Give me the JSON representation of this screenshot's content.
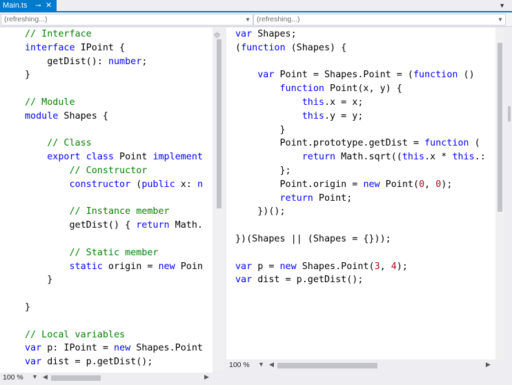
{
  "tab": {
    "title": "Main.ts",
    "pin_glyph": "⊸",
    "close_glyph": "✕"
  },
  "navbar": {
    "left_combo": "(refreshing...)",
    "right_combo": "(refreshing...)"
  },
  "left_zoom": "100 %",
  "right_zoom": "100 %",
  "left_code": [
    [
      [
        "cm",
        "// Interface"
      ]
    ],
    [
      [
        "kw",
        "interface"
      ],
      [
        "",
        "IPoint {"
      ]
    ],
    [
      [
        "",
        "    getDist(): "
      ],
      [
        "kw",
        "number"
      ],
      [
        "",
        ";"
      ]
    ],
    [
      [
        "",
        "}"
      ]
    ],
    [
      [
        "",
        ""
      ]
    ],
    [
      [
        "cm",
        "// Module"
      ]
    ],
    [
      [
        "kw",
        "module"
      ],
      [
        "",
        "Shapes {"
      ]
    ],
    [
      [
        "",
        ""
      ]
    ],
    [
      [
        "",
        "    "
      ],
      [
        "cm",
        "// Class"
      ]
    ],
    [
      [
        "",
        "    "
      ],
      [
        "kw",
        "export"
      ],
      [
        "",
        ""
      ],
      [
        "kw",
        "class"
      ],
      [
        "",
        "Point "
      ],
      [
        "kw",
        "implement"
      ]
    ],
    [
      [
        "",
        "        "
      ],
      [
        "cm",
        "// Constructor"
      ]
    ],
    [
      [
        "",
        "        "
      ],
      [
        "kw",
        "constructor"
      ],
      [
        "",
        " ("
      ],
      [
        "kw",
        "public"
      ],
      [
        "",
        " x: "
      ],
      [
        "kw",
        "n"
      ]
    ],
    [
      [
        "",
        ""
      ]
    ],
    [
      [
        "",
        "        "
      ],
      [
        "cm",
        "// Instance member"
      ]
    ],
    [
      [
        "",
        "        getDist() { "
      ],
      [
        "kw",
        "return"
      ],
      [
        "",
        " Math."
      ]
    ],
    [
      [
        "",
        ""
      ]
    ],
    [
      [
        "",
        "        "
      ],
      [
        "cm",
        "// Static member"
      ]
    ],
    [
      [
        "",
        "        "
      ],
      [
        "kw",
        "static"
      ],
      [
        "",
        " origin = "
      ],
      [
        "kw",
        "new"
      ],
      [
        "",
        " Poin"
      ]
    ],
    [
      [
        "",
        "    }"
      ]
    ],
    [
      [
        "",
        ""
      ]
    ],
    [
      [
        "",
        "}"
      ]
    ],
    [
      [
        "",
        ""
      ]
    ],
    [
      [
        "cm",
        "// Local variables"
      ]
    ],
    [
      [
        "kw",
        "var"
      ],
      [
        "",
        " p: IPoint = "
      ],
      [
        "kw",
        "new"
      ],
      [
        "",
        " Shapes.Point"
      ]
    ],
    [
      [
        "kw",
        "var"
      ],
      [
        "",
        " dist = p.getDist();"
      ]
    ]
  ],
  "right_code": [
    [
      [
        "kw",
        "var"
      ],
      [
        "",
        " Shapes;"
      ]
    ],
    [
      [
        "",
        "("
      ],
      [
        "kw",
        "function"
      ],
      [
        "",
        " (Shapes) {"
      ]
    ],
    [
      [
        "",
        ""
      ]
    ],
    [
      [
        "",
        "    "
      ],
      [
        "kw",
        "var"
      ],
      [
        "",
        " Point = Shapes.Point = ("
      ],
      [
        "kw",
        "function"
      ],
      [
        "",
        " () "
      ]
    ],
    [
      [
        "",
        "        "
      ],
      [
        "kw",
        "function"
      ],
      [
        "",
        " Point(x, y) {"
      ]
    ],
    [
      [
        "",
        "            "
      ],
      [
        "kw",
        "this"
      ],
      [
        "",
        ".x = x;"
      ]
    ],
    [
      [
        "",
        "            "
      ],
      [
        "kw",
        "this"
      ],
      [
        "",
        ".y = y;"
      ]
    ],
    [
      [
        "",
        "        }"
      ]
    ],
    [
      [
        "",
        "        Point.prototype.getDist = "
      ],
      [
        "kw",
        "function"
      ],
      [
        "",
        " ("
      ]
    ],
    [
      [
        "",
        "            "
      ],
      [
        "kw",
        "return"
      ],
      [
        "",
        " Math.sqrt(("
      ],
      [
        "kw",
        "this"
      ],
      [
        "",
        ".x * "
      ],
      [
        "kw",
        "this"
      ],
      [
        "",
        ".:"
      ]
    ],
    [
      [
        "",
        "        };"
      ]
    ],
    [
      [
        "",
        "        Point.origin = "
      ],
      [
        "kw",
        "new"
      ],
      [
        "",
        " Point("
      ],
      [
        "num",
        "0"
      ],
      [
        "",
        ", "
      ],
      [
        "num",
        "0"
      ],
      [
        "",
        ");"
      ]
    ],
    [
      [
        "",
        "        "
      ],
      [
        "kw",
        "return"
      ],
      [
        "",
        " Point;"
      ]
    ],
    [
      [
        "",
        "    })();"
      ]
    ],
    [
      [
        "",
        ""
      ]
    ],
    [
      [
        "",
        "})(Shapes || (Shapes = {}));"
      ]
    ],
    [
      [
        "",
        ""
      ]
    ],
    [
      [
        "kw",
        "var"
      ],
      [
        "",
        " p = "
      ],
      [
        "kw",
        "new"
      ],
      [
        "",
        " Shapes.Point("
      ],
      [
        "num",
        "3"
      ],
      [
        "",
        ", "
      ],
      [
        "num",
        "4"
      ],
      [
        "",
        ");"
      ]
    ],
    [
      [
        "kw",
        "var"
      ],
      [
        "",
        " dist = p.getDist();"
      ]
    ]
  ]
}
